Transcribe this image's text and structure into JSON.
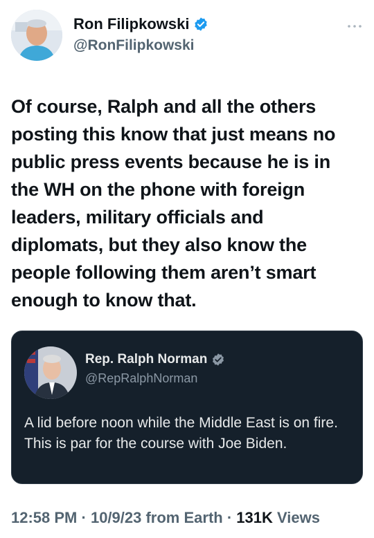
{
  "author": {
    "display_name": "Ron Filipkowski",
    "handle": "@RonFilipkowski"
  },
  "tweet": {
    "text": "Of course, Ralph and all the others posting this know that just means no public press events because he is in the WH on the phone with foreign leaders, military officials and diplomats, but they also know the people following them aren’t smart enough to know that."
  },
  "quoted_tweet": {
    "display_name": "Rep. Ralph Norman",
    "handle": "@RepRalphNorman",
    "text": "A lid before noon while the Middle East is on fire. This is par for the course with Joe Biden."
  },
  "meta": {
    "time": "12:58 PM",
    "separator1": " · ",
    "date": "10/9/23",
    "source": " from Earth",
    "separator2": " · ",
    "views_count": "131K",
    "views_label": " Views"
  },
  "colors": {
    "verified_blue": "#1d9bf0",
    "quote_bg": "#15202b"
  },
  "icons": {
    "verified": "verified-badge-icon",
    "more": "more-dots-icon"
  }
}
